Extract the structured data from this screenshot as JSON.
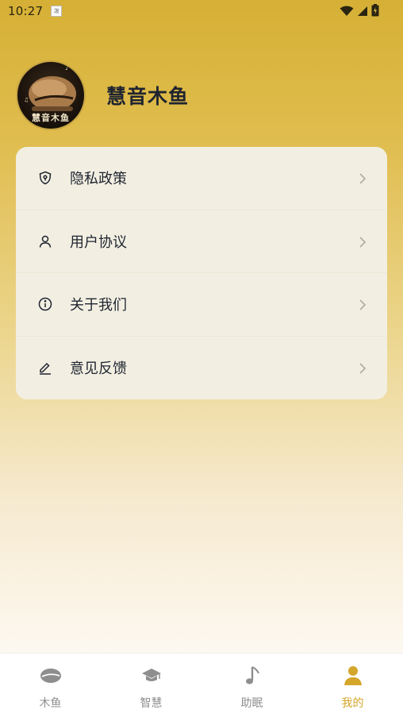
{
  "status_bar": {
    "time": "10:27",
    "notification_icon": "app-notification-icon",
    "notification_text": "泼",
    "icons": [
      "wifi-icon",
      "signal-icon",
      "battery-charging-icon"
    ]
  },
  "profile": {
    "avatar_caption": "慧音木鱼",
    "app_name": "慧音木鱼"
  },
  "menu": {
    "items": [
      {
        "label": "隐私政策",
        "icon": "shield-lock-icon"
      },
      {
        "label": "用户协议",
        "icon": "user-icon"
      },
      {
        "label": "关于我们",
        "icon": "info-icon"
      },
      {
        "label": "意见反馈",
        "icon": "edit-icon"
      }
    ]
  },
  "tabbar": {
    "items": [
      {
        "label": "木鱼",
        "icon": "wooden-fish-icon",
        "active": false
      },
      {
        "label": "智慧",
        "icon": "graduation-cap-icon",
        "active": false
      },
      {
        "label": "助眠",
        "icon": "music-note-icon",
        "active": false
      },
      {
        "label": "我的",
        "icon": "person-icon",
        "active": true
      }
    ]
  },
  "colors": {
    "accent": "#d4a62a",
    "card_background": "#f2efe2",
    "text_primary": "#1f2430",
    "tab_inactive": "#8e8e8e"
  }
}
